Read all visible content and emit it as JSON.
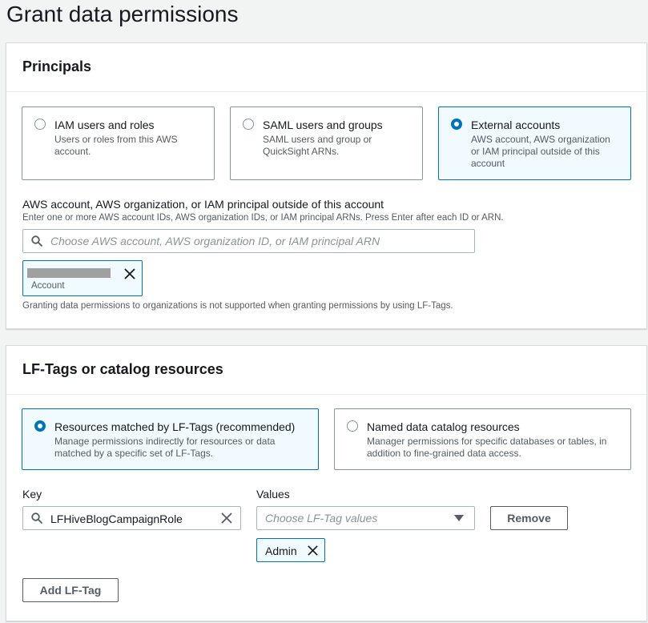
{
  "page": {
    "title": "Grant data permissions"
  },
  "principals": {
    "heading": "Principals",
    "options": [
      {
        "title": "IAM users and roles",
        "desc": "Users or roles from this AWS account.",
        "selected": false
      },
      {
        "title": "SAML users and groups",
        "desc": "SAML users and group or QuickSight ARNs.",
        "selected": false
      },
      {
        "title": "External accounts",
        "desc": "AWS account, AWS organization or IAM principal outside of this account",
        "selected": true
      }
    ],
    "field_label": "AWS account, AWS organization, or IAM principal outside of this account",
    "field_desc": "Enter one or more AWS account IDs, AWS organization IDs, or IAM principal ARNs. Press Enter after each ID or ARN.",
    "search_placeholder": "Choose AWS account, AWS organization ID, or IAM principal ARN",
    "token": {
      "value_redacted": true,
      "sublabel": "Account"
    },
    "note": "Granting data permissions to organizations is not supported when granting permissions by using LF-Tags."
  },
  "lftags": {
    "heading": "LF-Tags or catalog resources",
    "options": [
      {
        "title": "Resources matched by LF-Tags (recommended)",
        "desc": "Manage permissions indirectly for resources or data matched by a specific set of LF-Tags.",
        "selected": true
      },
      {
        "title": "Named data catalog resources",
        "desc": "Manager permissions for specific databases or tables, in addition to fine-grained data access.",
        "selected": false
      }
    ],
    "key_label": "Key",
    "key_value": "LFHiveBlogCampaignRole",
    "values_label": "Values",
    "values_placeholder": "Choose LF-Tag values",
    "remove_label": "Remove",
    "value_tokens": [
      "Admin"
    ],
    "add_label": "Add LF-Tag"
  },
  "colors": {
    "accent": "#0073bb",
    "selected_bg": "#f1faff",
    "redaction": "#a0a0a0"
  }
}
